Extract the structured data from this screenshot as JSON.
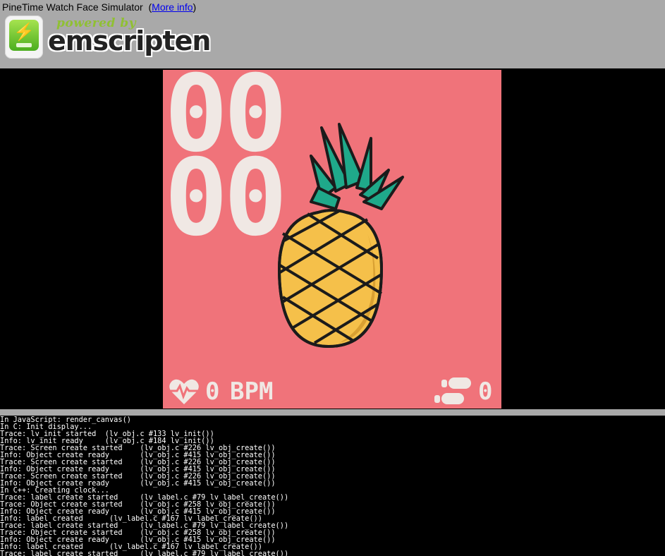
{
  "header": {
    "title": "PineTime Watch Face Simulator",
    "more_info": "(More info)",
    "more_info_link": "More info",
    "powered_by": "powered by",
    "brand": "emscripten"
  },
  "watch": {
    "hour": "00",
    "minute": "00",
    "heart_rate": "0",
    "heart_unit": "BPM",
    "steps": "0",
    "colors": {
      "background": "#f0737a",
      "text": "#f0e8e4",
      "pineapple_body": "#f5c04a",
      "pineapple_leaves": "#1fa98a"
    }
  },
  "console": {
    "lines": [
      "In JavaScript: render_canvas()",
      "In C: Init display...",
      "Trace: lv_init started  (lv_obj.c #133 lv_init())",
      "Info: lv_init ready     (lv_obj.c #184 lv_init())",
      "Trace: Screen create started    (lv_obj.c #226 lv_obj_create())",
      "Info: Object create ready       (lv_obj.c #415 lv_obj_create())",
      "Trace: Screen create started    (lv_obj.c #226 lv_obj_create())",
      "Info: Object create ready       (lv_obj.c #415 lv_obj_create())",
      "Trace: Screen create started    (lv_obj.c #226 lv_obj_create())",
      "Info: Object create ready       (lv_obj.c #415 lv_obj_create())",
      "In C++: Creating clock...",
      "Trace: label create started     (lv_label.c #79 lv_label_create())",
      "Trace: Object create started    (lv_obj.c #258 lv_obj_create())",
      "Info: Object create ready       (lv_obj.c #415 lv_obj_create())",
      "Info: label created      (lv_label.c #167 lv_label_create())",
      "Trace: label create started     (lv_label.c #79 lv_label_create())",
      "Trace: Object create started    (lv_obj.c #258 lv_obj_create())",
      "Info: Object create ready       (lv_obj.c #415 lv_obj_create())",
      "Info: label created      (lv_label.c #167 lv_label_create())",
      "Trace: label create started     (lv_label.c #79 lv_label_create())"
    ]
  }
}
